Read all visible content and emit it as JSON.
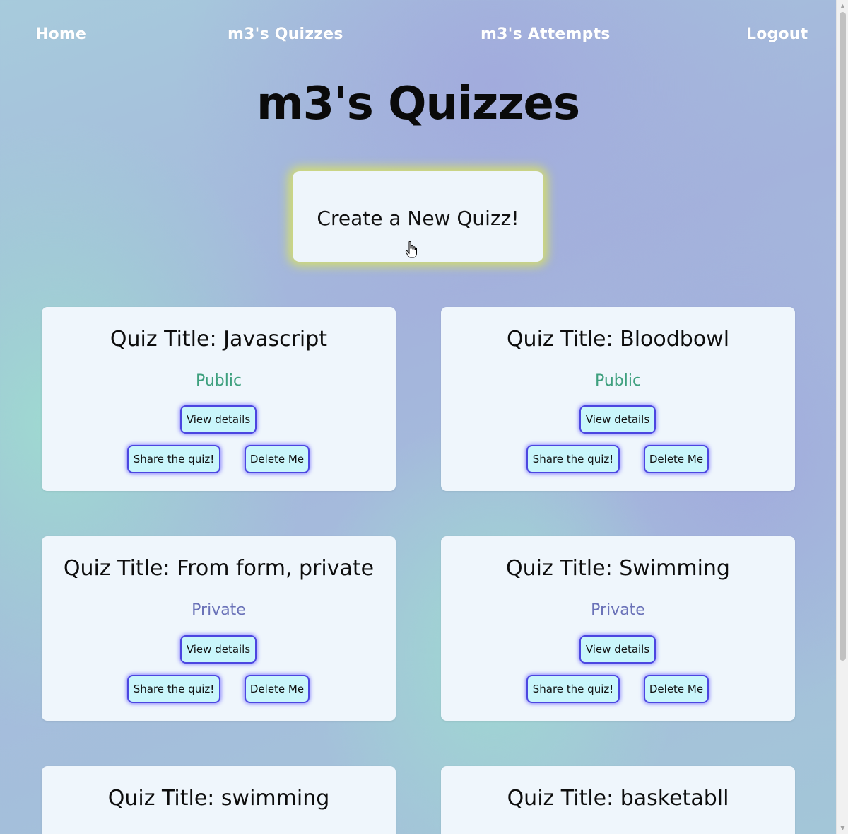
{
  "nav": {
    "home": "Home",
    "quizzes": "m3's Quizzes",
    "attempts": "m3's Attempts",
    "logout": "Logout"
  },
  "page_title": "m3's Quizzes",
  "create_button": "Create a New Quizz!",
  "buttons": {
    "view": "View details",
    "share": "Share the quiz!",
    "delete": "Delete Me"
  },
  "quizzes": [
    {
      "title": "Quiz Title: Javascript",
      "visibility": "Public"
    },
    {
      "title": "Quiz Title: Bloodbowl",
      "visibility": "Public"
    },
    {
      "title": "Quiz Title: From form, private",
      "visibility": "Private"
    },
    {
      "title": "Quiz Title: Swimming",
      "visibility": "Private"
    },
    {
      "title": "Quiz Title: swimming",
      "visibility": ""
    },
    {
      "title": "Quiz Title: basketabll",
      "visibility": ""
    }
  ],
  "colors": {
    "public": "#3ea07e",
    "private": "#6a72b8",
    "button_border": "#4b46e0",
    "create_glow": "#dce45a"
  },
  "icons": {
    "cursor": "hand-pointer-icon",
    "scroll_up": "scroll-up-arrow-icon",
    "scroll_down": "scroll-down-arrow-icon"
  }
}
